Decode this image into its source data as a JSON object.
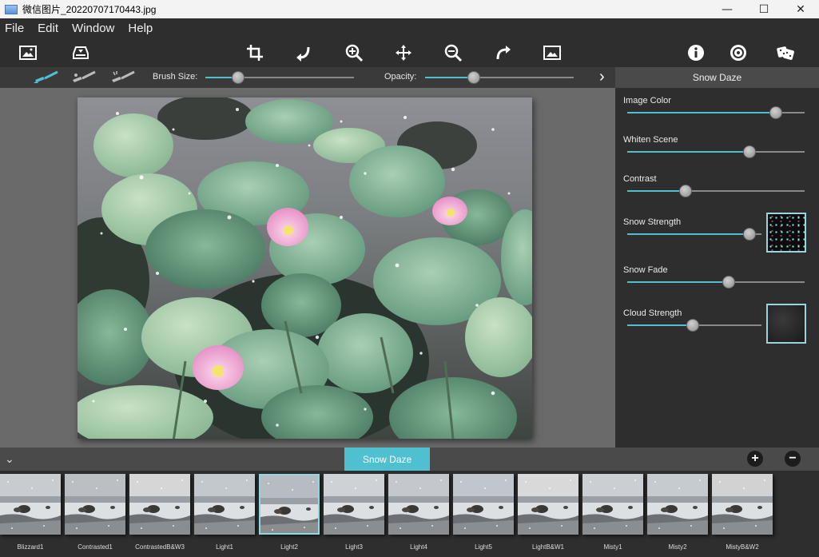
{
  "window": {
    "title": "微信图片_20220707170443.jpg",
    "minimize": "—",
    "maximize": "☐",
    "close": "✕"
  },
  "menu": [
    "File",
    "Edit",
    "Window",
    "Help"
  ],
  "toolbar": {
    "left_icons": [
      "open-image-icon",
      "save-image-icon"
    ],
    "center_icons": [
      "crop-icon",
      "rotate-left-icon",
      "zoom-in-icon",
      "move-icon",
      "zoom-out-icon",
      "rotate-right-icon",
      "fit-image-icon"
    ],
    "right_icons": [
      "info-icon",
      "settings-icon",
      "randomize-icon"
    ]
  },
  "brush": {
    "brush_size_label": "Brush Size:",
    "brush_size": 0.22,
    "opacity_label": "Opacity:",
    "opacity": 0.33,
    "next": "›"
  },
  "panel": {
    "title": "Snow Daze",
    "adjustments": [
      {
        "label": "Image Color",
        "value": 0.84,
        "preview": false
      },
      {
        "label": "Whiten Scene",
        "value": 0.69,
        "preview": false
      },
      {
        "label": "Contrast",
        "value": 0.33,
        "preview": false
      },
      {
        "label": "Snow Strength",
        "value": 0.91,
        "preview": true
      },
      {
        "label": "Snow Fade",
        "value": 0.57,
        "preview": false
      },
      {
        "label": "Cloud Strength",
        "value": 0.49,
        "preview": true
      }
    ]
  },
  "bottombar": {
    "collapse": "⌄",
    "active_tab": "Snow Daze",
    "add": "+",
    "remove": "−"
  },
  "presets": [
    {
      "label": "Blizzard1",
      "selected": false
    },
    {
      "label": "Contrasted1",
      "selected": false
    },
    {
      "label": "ContrastedB&W3",
      "selected": false
    },
    {
      "label": "Light1",
      "selected": false
    },
    {
      "label": "Light2",
      "selected": true
    },
    {
      "label": "Light3",
      "selected": false
    },
    {
      "label": "Light4",
      "selected": false
    },
    {
      "label": "Light5",
      "selected": false
    },
    {
      "label": "LightB&W1",
      "selected": false
    },
    {
      "label": "Misty1",
      "selected": false
    },
    {
      "label": "Misty2",
      "selected": false
    },
    {
      "label": "MistyB&W2",
      "selected": false
    }
  ],
  "colors": {
    "accent": "#4fc0cf",
    "panel": "#2e2e2e",
    "canvas": "#6a6a6a"
  }
}
